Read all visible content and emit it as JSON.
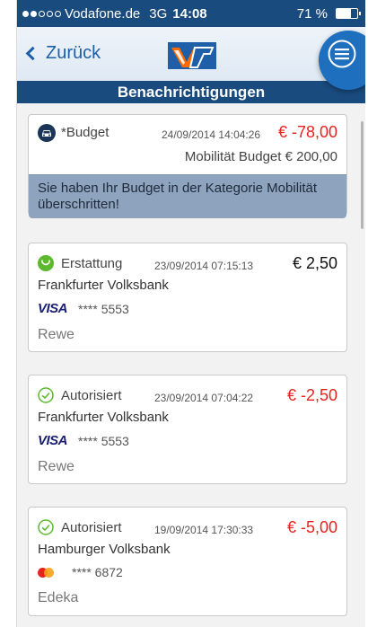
{
  "status_bar": {
    "carrier": "Vodafone.de",
    "network": "3G",
    "time": "14:08",
    "battery": "71 %",
    "battery_level": 0.71
  },
  "nav": {
    "back_label": "Zurück",
    "logo": "volksbank-logo-icon",
    "menu": "hamburger-menu-icon"
  },
  "title": "Benachrichtigungen",
  "notifications": [
    {
      "icon": "car-icon",
      "type": "*Budget",
      "date": "24/09/2014 14:04:26",
      "amount": "€ -78,00",
      "sub": "Mobilität Budget € 200,00",
      "alert": "Sie haben Ihr Budget in der Kategorie Mobilität überschritten!"
    },
    {
      "icon": "refund-icon",
      "type": "Erstattung",
      "date": "23/09/2014 07:15:13",
      "amount": "€ 2,50",
      "bank": "Frankfurter Volksbank",
      "card_brand": "VISA",
      "card_number": "**** 5553",
      "merchant": "Rewe"
    },
    {
      "icon": "check-circle-icon",
      "type": "Autorisiert",
      "date": "23/09/2014 07:04:22",
      "amount": "€ -2,50",
      "bank": "Frankfurter Volksbank",
      "card_brand": "VISA",
      "card_number": "**** 5553",
      "merchant": "Rewe"
    },
    {
      "icon": "check-circle-icon",
      "type": "Autorisiert",
      "date": "19/09/2014 17:30:33",
      "amount": "€ -5,00",
      "bank": "Hamburger Volksbank",
      "card_brand": "mastercard-icon",
      "card_number": "**** 6872",
      "merchant": "Edeka"
    }
  ],
  "colors": {
    "brand_blue": "#1a4b7e",
    "accent_blue": "#1f6fbf",
    "negative_red": "#e8231f",
    "success_green": "#5cb82e"
  }
}
